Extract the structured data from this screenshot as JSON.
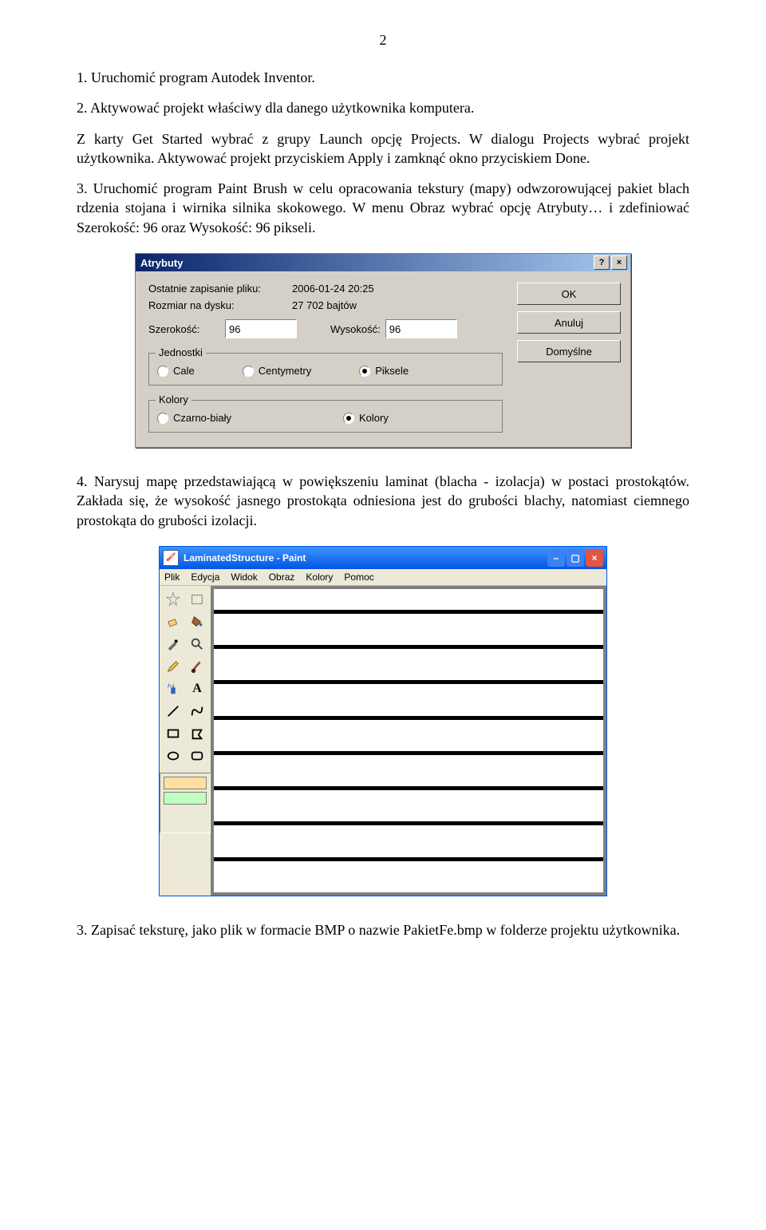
{
  "page_number": "2",
  "paragraphs": {
    "p1": "1.  Uruchomić program Autodek Inventor.",
    "p2": "2.  Aktywować projekt właściwy dla danego użytkownika komputera.",
    "p3": "Z karty Get Started wybrać z grupy Launch opcję Projects. W dialogu Projects wybrać projekt użytkownika. Aktywować projekt przyciskiem Apply i zamknąć okno przyciskiem Done.",
    "p4": "3. Uruchomić program Paint Brush w celu opracowania tekstury (mapy) odwzorowującej pakiet blach rdzenia stojana i wirnika silnika skokowego. W menu Obraz wybrać opcję Atrybuty… i zdefiniować Szerokość: 96 oraz Wysokość: 96 pikseli.",
    "p5": "4. Narysuj mapę przedstawiającą w powiększeniu laminat (blacha - izolacja) w postaci prostokątów. Zakłada się, że wysokość jasnego prostokąta odniesiona jest do grubości blachy, natomiast ciemnego prostokąta do grubości izolacji.",
    "p6": "3. Zapisać teksturę, jako plik w formacie BMP o nazwie PakietFe.bmp w folderze projektu użytkownika."
  },
  "dlg_atrybuty": {
    "title": "Atrybuty",
    "help": "?",
    "close": "×",
    "last_save_label": "Ostatnie zapisanie pliku:",
    "last_save_value": "2006-01-24 20:25",
    "disk_label": "Rozmiar na dysku:",
    "disk_value": "27 702 bajtów",
    "width_label": "Szerokość:",
    "width_value": "96",
    "height_label": "Wysokość:",
    "height_value": "96",
    "units_title": "Jednostki",
    "unit_inches": "Cale",
    "unit_cm": "Centymetry",
    "unit_px": "Piksele",
    "colors_title": "Kolory",
    "color_bw": "Czarno-biały",
    "color_colors": "Kolory",
    "btn_ok": "OK",
    "btn_cancel": "Anuluj",
    "btn_default": "Domyślne"
  },
  "paint": {
    "title": "LaminatedStructure - Paint",
    "menu": [
      "Plik",
      "Edycja",
      "Widok",
      "Obraz",
      "Kolory",
      "Pomoc"
    ],
    "tools": [
      "star-select-icon",
      "rect-select-icon",
      "eraser-icon",
      "fill-icon",
      "picker-icon",
      "zoom-icon",
      "pencil-icon",
      "brush-icon",
      "spray-icon",
      "text-icon",
      "line-icon",
      "curve-icon",
      "rect-icon",
      "polygon-icon",
      "ellipse-icon",
      "roundrect-icon"
    ]
  }
}
